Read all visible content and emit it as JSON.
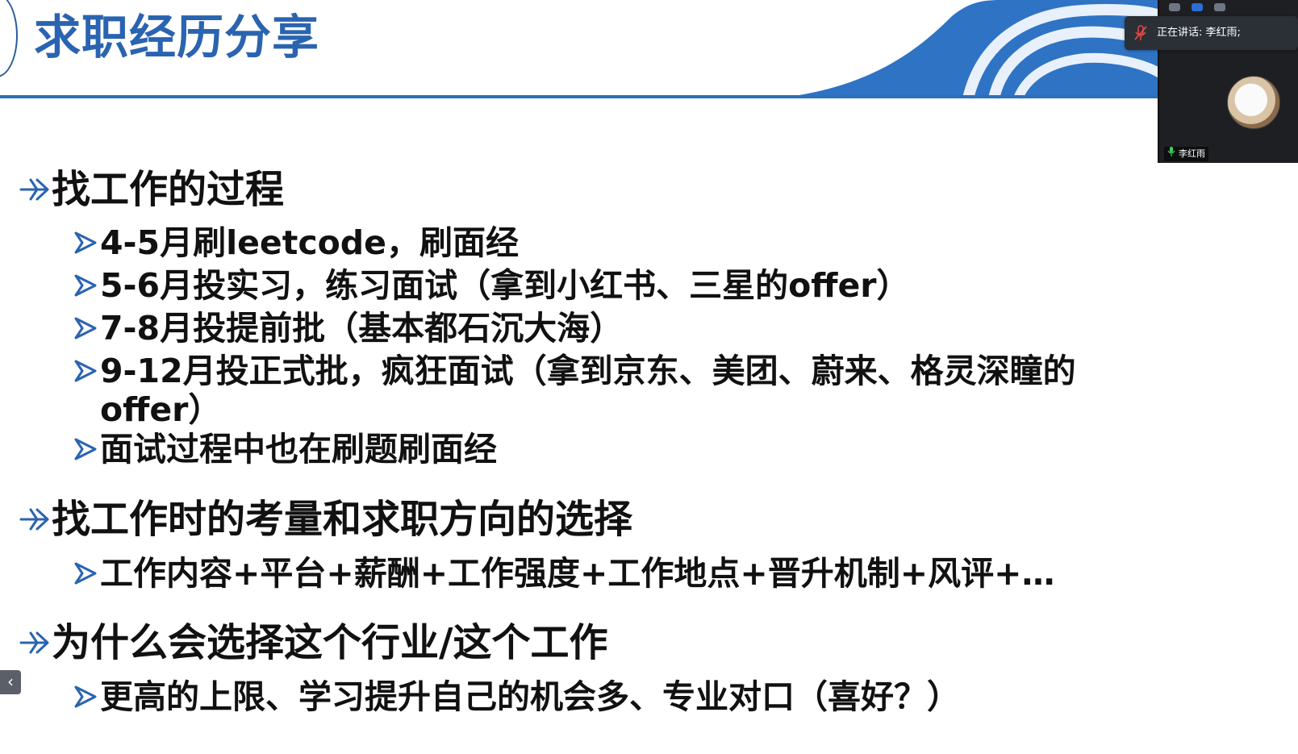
{
  "slide": {
    "title": "求职经历分享",
    "accent_color": "#2a64b0",
    "sections": [
      {
        "heading": "找工作的过程",
        "items": [
          "4-5月刷leetcode，刷面经",
          "5-6月投实习，练习面试（拿到小红书、三星的offer）",
          "7-8月投提前批（基本都石沉大海）",
          "9-12月投正式批，疯狂面试（拿到京东、美团、蔚来、格灵深瞳的offer）",
          "面试过程中也在刷题刷面经"
        ]
      },
      {
        "heading": "找工作时的考量和求职方向的选择",
        "items": [
          "工作内容+平台+薪酬+工作强度+工作地点+晋升机制+风评+…"
        ]
      },
      {
        "heading": "为什么会选择这个行业/这个工作",
        "items": [
          "更高的上限、学习提升自己的机会多、专业对口（喜好？）"
        ]
      }
    ]
  },
  "meeting": {
    "speaking_now": "正在讲话: 李红雨;",
    "participant_name": "李红雨",
    "collapse_label": "‹",
    "icons": [
      "mic-muted-icon",
      "mic-active-icon",
      "avatar"
    ]
  }
}
